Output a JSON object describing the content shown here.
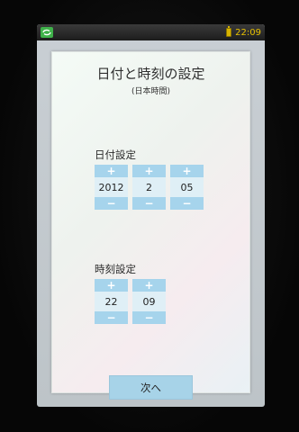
{
  "status_bar": {
    "time": "22:09",
    "sync_icon": "sync-icon",
    "battery_icon": "battery-icon",
    "time_color": "#e8c000"
  },
  "dialog": {
    "title": "日付と時刻の設定",
    "subtitle": "(日本時間)"
  },
  "date_setting": {
    "label": "日付設定",
    "year": "2012",
    "month": "2",
    "day": "05"
  },
  "time_setting": {
    "label": "時刻設定",
    "hour": "22",
    "minute": "09"
  },
  "spinner": {
    "plus": "+",
    "minus": "−"
  },
  "next_button": {
    "label": "次へ"
  },
  "colors": {
    "spinner_button": "#a6d4ec",
    "spinner_value_bg": "#dfeff6",
    "next_button": "#a7d3e8"
  }
}
